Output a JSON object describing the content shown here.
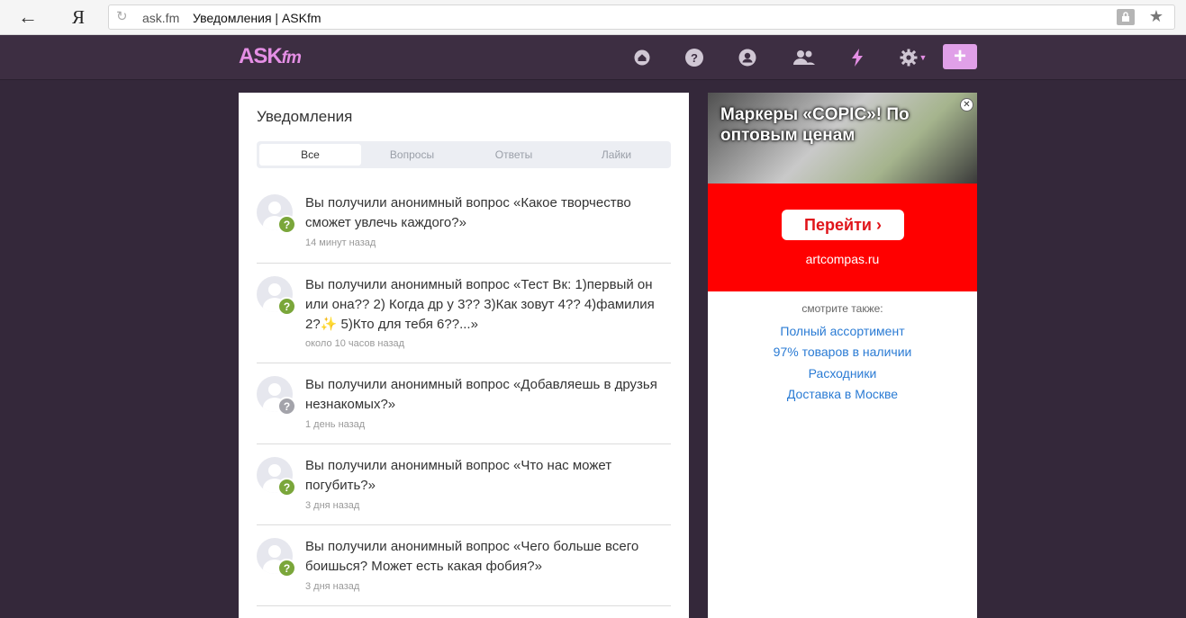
{
  "browser": {
    "back_icon": "←",
    "logo": "Я",
    "reload_icon": "↻",
    "url_domain": "ask.fm",
    "page_title": "Уведомления | ASKfm",
    "star_icon": "★"
  },
  "header": {
    "logo_main": "ASK",
    "logo_suffix": "fm",
    "plus_label": "+",
    "nav_icons": [
      "home-icon",
      "help-icon",
      "profile-icon",
      "friends-icon",
      "bolt-icon",
      "gear-icon"
    ],
    "accent_color": "#e58fe5"
  },
  "notifications": {
    "title": "Уведомления",
    "tabs": [
      "Все",
      "Вопросы",
      "Ответы",
      "Лайки"
    ],
    "items": [
      {
        "text": "Вы получили анонимный вопрос «Какое творчество сможет увлечь каждого?»",
        "time": "14 минут назад"
      },
      {
        "text": "Вы получили анонимный вопрос «Тест Вк: 1)первый он или она?? 2) Когда др у 3?? 3)Как зовут 4?? 4)фамилия 2?✨ 5)Кто для тебя 6??...»",
        "time": "около 10 часов назад"
      },
      {
        "text": "Вы получили анонимный вопрос «Добавляешь в друзья незнакомых?»",
        "time": "1 день назад"
      },
      {
        "text": "Вы получили анонимный вопрос «Что нас может погубить?»",
        "time": "3 дня назад"
      },
      {
        "text": "Вы получили анонимный вопрос «Чего больше всего боишься? Может есть какая фобия?»",
        "time": "3 дня назад"
      }
    ]
  },
  "ad": {
    "headline": "Маркеры «COPIC»! По оптовым ценам",
    "button": "Перейти ›",
    "domain": "artcompas.ru",
    "see_also": "смотрите также:",
    "links": [
      "Полный ассортимент",
      "97% товаров в наличии",
      "Расходники",
      "Доставка в Москве"
    ]
  }
}
